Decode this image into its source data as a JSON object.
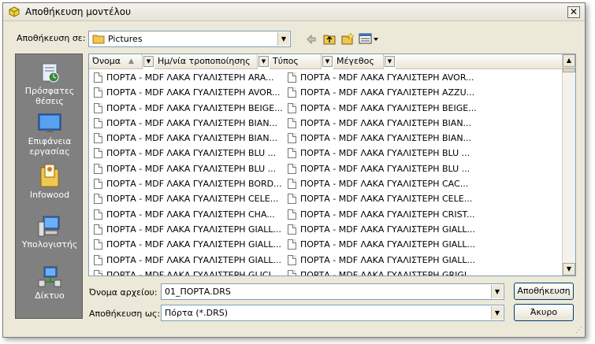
{
  "window": {
    "title": "Αποθήκευση μοντέλου",
    "close_symbol": "✕"
  },
  "savein": {
    "label": "Αποθήκευση σε:",
    "value": "Pictures"
  },
  "toolbar": {
    "back_icon": "arrow-left-icon",
    "up_icon": "folder-up-icon",
    "new_folder_icon": "new-folder-icon",
    "views_icon": "views-menu-icon"
  },
  "places": [
    {
      "label": "Πρόσφατες θέσεις",
      "icon": "recent-places-icon"
    },
    {
      "label": "Επιφάνεια εργασίας",
      "icon": "desktop-icon"
    },
    {
      "label": "Infowood",
      "icon": "user-folder-icon"
    },
    {
      "label": "Υπολογιστής",
      "icon": "computer-icon"
    },
    {
      "label": "Δίκτυο",
      "icon": "network-icon"
    }
  ],
  "columns": [
    "Όνομα",
    "Ημ/νία τροποποίησης",
    "Τύπος",
    "Μέγεθος"
  ],
  "files_col1": [
    "ΠΟΡΤΑ - MDF ΛΑΚΑ ΓΥΑΛΙΣΤΕΡΗ ARA...",
    "ΠΟΡΤΑ - MDF ΛΑΚΑ ΓΥΑΛΙΣΤΕΡΗ AVOR...",
    "ΠΟΡΤΑ - MDF ΛΑΚΑ ΓΥΑΛΙΣΤΕΡΗ BEIGE...",
    "ΠΟΡΤΑ - MDF ΛΑΚΑ ΓΥΑΛΙΣΤΕΡΗ BIAN...",
    "ΠΟΡΤΑ - MDF ΛΑΚΑ ΓΥΑΛΙΣΤΕΡΗ BIAN...",
    "ΠΟΡΤΑ - MDF ΛΑΚΑ ΓΥΑΛΙΣΤΕΡΗ BLU ...",
    "ΠΟΡΤΑ - MDF ΛΑΚΑ ΓΥΑΛΙΣΤΕΡΗ BLU ...",
    "ΠΟΡΤΑ - MDF ΛΑΚΑ ΓΥΑΛΙΣΤΕΡΗ BORD...",
    "ΠΟΡΤΑ - MDF ΛΑΚΑ ΓΥΑΛΙΣΤΕΡΗ CELE...",
    "ΠΟΡΤΑ - MDF ΛΑΚΑ ΓΥΑΛΙΣΤΕΡΗ CHA...",
    "ΠΟΡΤΑ - MDF ΛΑΚΑ ΓΥΑΛΙΣΤΕΡΗ GIALL...",
    "ΠΟΡΤΑ - MDF ΛΑΚΑ ΓΥΑΛΙΣΤΕΡΗ GIALL...",
    "ΠΟΡΤΑ - MDF ΛΑΚΑ ΓΥΑΛΙΣΤΕΡΗ GIALL...",
    "ΠΟΡΤΑ - MDF ΛΑΚΑ ΓΥΑΛΙΣΤΕΡΗ GLICI..."
  ],
  "files_col2": [
    "ΠΟΡΤΑ - MDF ΛΑΚΑ ΓΥΑΛΙΣΤΕΡΗ AVOR...",
    "ΠΟΡΤΑ - MDF ΛΑΚΑ ΓΥΑΛΙΣΤΕΡΗ AZZU...",
    "ΠΟΡΤΑ - MDF ΛΑΚΑ ΓΥΑΛΙΣΤΕΡΗ BEIGE...",
    "ΠΟΡΤΑ - MDF ΛΑΚΑ ΓΥΑΛΙΣΤΕΡΗ BIAN...",
    "ΠΟΡΤΑ - MDF ΛΑΚΑ ΓΥΑΛΙΣΤΕΡΗ BIAN...",
    "ΠΟΡΤΑ - MDF ΛΑΚΑ ΓΥΑΛΙΣΤΕΡΗ BLU ...",
    "ΠΟΡΤΑ - MDF ΛΑΚΑ ΓΥΑΛΙΣΤΕΡΗ BLU ...",
    "ΠΟΡΤΑ - MDF ΛΑΚΑ ΓΥΑΛΙΣΤΕΡΗ CAC...",
    "ΠΟΡΤΑ - MDF ΛΑΚΑ ΓΥΑΛΙΣΤΕΡΗ CELE...",
    "ΠΟΡΤΑ - MDF ΛΑΚΑ ΓΥΑΛΙΣΤΕΡΗ CRIST...",
    "ΠΟΡΤΑ - MDF ΛΑΚΑ ΓΥΑΛΙΣΤΕΡΗ GIALL...",
    "ΠΟΡΤΑ - MDF ΛΑΚΑ ΓΥΑΛΙΣΤΕΡΗ GIALL...",
    "ΠΟΡΤΑ - MDF ΛΑΚΑ ΓΥΑΛΙΣΤΕΡΗ GIALL...",
    "ΠΟΡΤΑ - MDF ΛΑΚΑ ΓΥΑΛΙΣΤΕΡΗ GRIGI..."
  ],
  "filename": {
    "label": "Όνομα αρχείου:",
    "value": "01_ΠΟΡΤΑ.DRS"
  },
  "filetype": {
    "label": "Αποθήκευση ως:",
    "value": "Πόρτα (*.DRS)"
  },
  "buttons": {
    "save": "Αποθήκευση",
    "cancel": "Άκυρο"
  },
  "colors": {
    "face": "#ece9d8",
    "places_panel": "#808080",
    "field_border": "#7f9db9",
    "button_border": "#003c74"
  }
}
